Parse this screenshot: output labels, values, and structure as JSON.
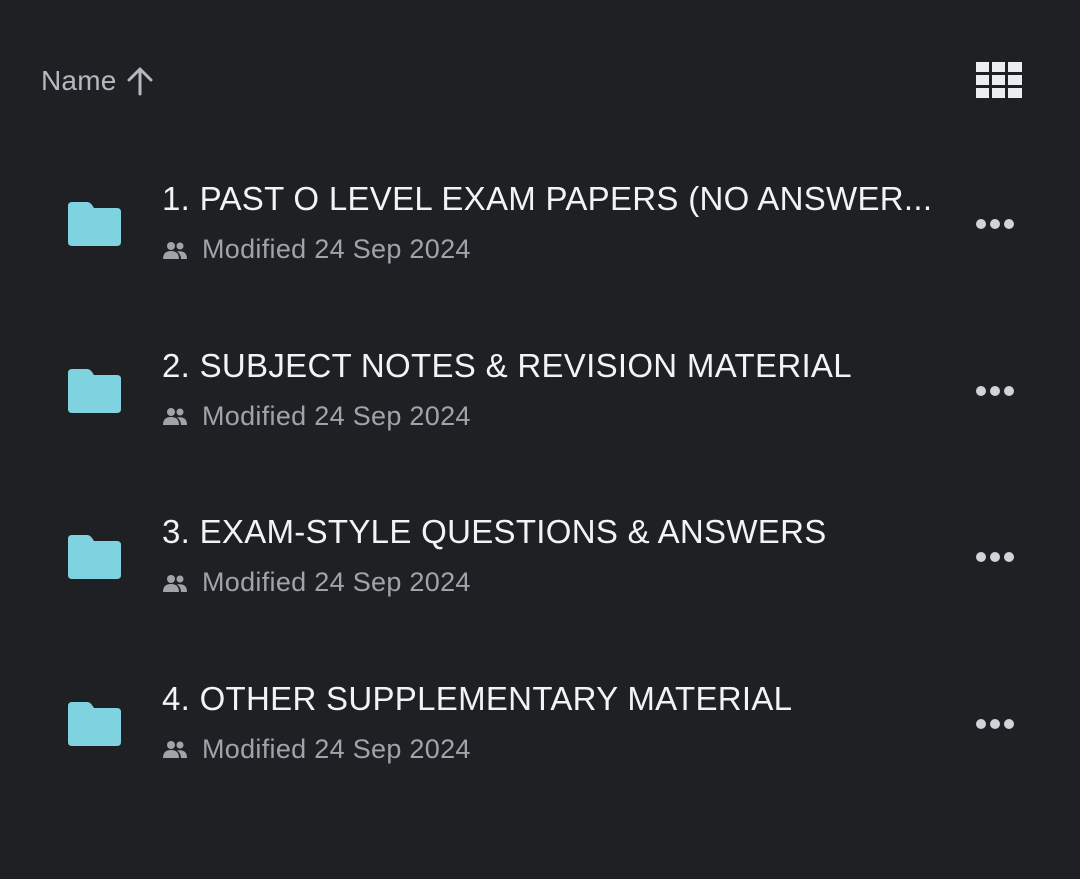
{
  "header": {
    "sort_label": "Name",
    "sort_direction_icon": "arrow-up-icon",
    "view_toggle_icon": "grid-view-icon"
  },
  "colors": {
    "background": "#1f2023",
    "folder": "#7fd3e0",
    "title_text": "#f2f3f5",
    "secondary_text": "#9fa4ab"
  },
  "items": [
    {
      "title": "1. PAST O LEVEL EXAM PAPERS (NO ANSWER...",
      "meta": "Modified 24 Sep 2024",
      "icon": "folder-icon",
      "shared_icon": "people-icon",
      "more_icon": "more-icon"
    },
    {
      "title": "2. SUBJECT NOTES & REVISION MATERIAL",
      "meta": "Modified 24 Sep 2024",
      "icon": "folder-icon",
      "shared_icon": "people-icon",
      "more_icon": "more-icon"
    },
    {
      "title": "3. EXAM-STYLE QUESTIONS & ANSWERS",
      "meta": "Modified 24 Sep 2024",
      "icon": "folder-icon",
      "shared_icon": "people-icon",
      "more_icon": "more-icon"
    },
    {
      "title": "4. OTHER SUPPLEMENTARY MATERIAL",
      "meta": "Modified 24 Sep 2024",
      "icon": "folder-icon",
      "shared_icon": "people-icon",
      "more_icon": "more-icon"
    }
  ]
}
